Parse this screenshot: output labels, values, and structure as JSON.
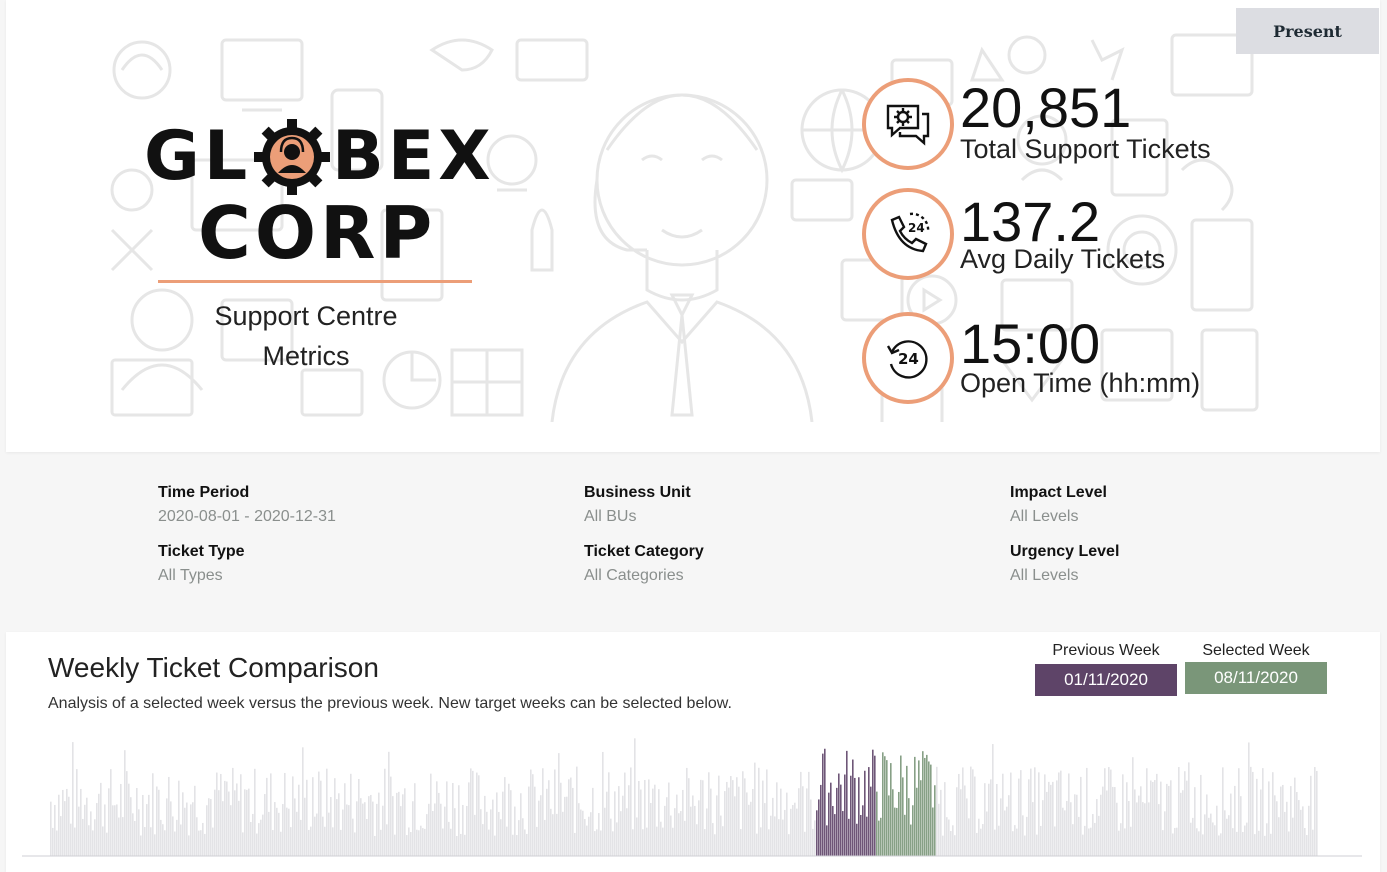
{
  "header": {
    "present_label": "Present",
    "logo_line1_a": "GL",
    "logo_line1_b": "BEX",
    "logo_line2": "CORP",
    "subtitle_line1": "Support Centre",
    "subtitle_line2": "Metrics",
    "accent_color": "#ec9e78"
  },
  "kpis": [
    {
      "value": "20,851",
      "label": "Total Support Tickets",
      "icon": "chat-gear-icon"
    },
    {
      "value": "137.2",
      "label": "Avg Daily Tickets",
      "icon": "phone-24-icon"
    },
    {
      "value": "15:00",
      "label": "Open Time (hh:mm)",
      "icon": "clock-24-icon"
    }
  ],
  "filters": [
    {
      "label": "Time Period",
      "value": "2020-08-01 - 2020-12-31"
    },
    {
      "label": "Business Unit",
      "value": "All BUs"
    },
    {
      "label": "Impact Level",
      "value": "All Levels"
    },
    {
      "label": "Ticket Type",
      "value": "All Types"
    },
    {
      "label": "Ticket Category",
      "value": "All Categories"
    },
    {
      "label": "Urgency Level",
      "value": "All Levels"
    }
  ],
  "weekly": {
    "title": "Weekly Ticket Comparison",
    "description": "Analysis of a selected week versus the previous week. New target weeks can be selected below.",
    "previous_week_label": "Previous Week",
    "previous_week_value": "01/11/2020",
    "selected_week_label": "Selected Week",
    "selected_week_value": "08/11/2020",
    "previous_color": "#5e4468",
    "selected_color": "#7a9679",
    "background_bar_color": "#d9d9de"
  }
}
